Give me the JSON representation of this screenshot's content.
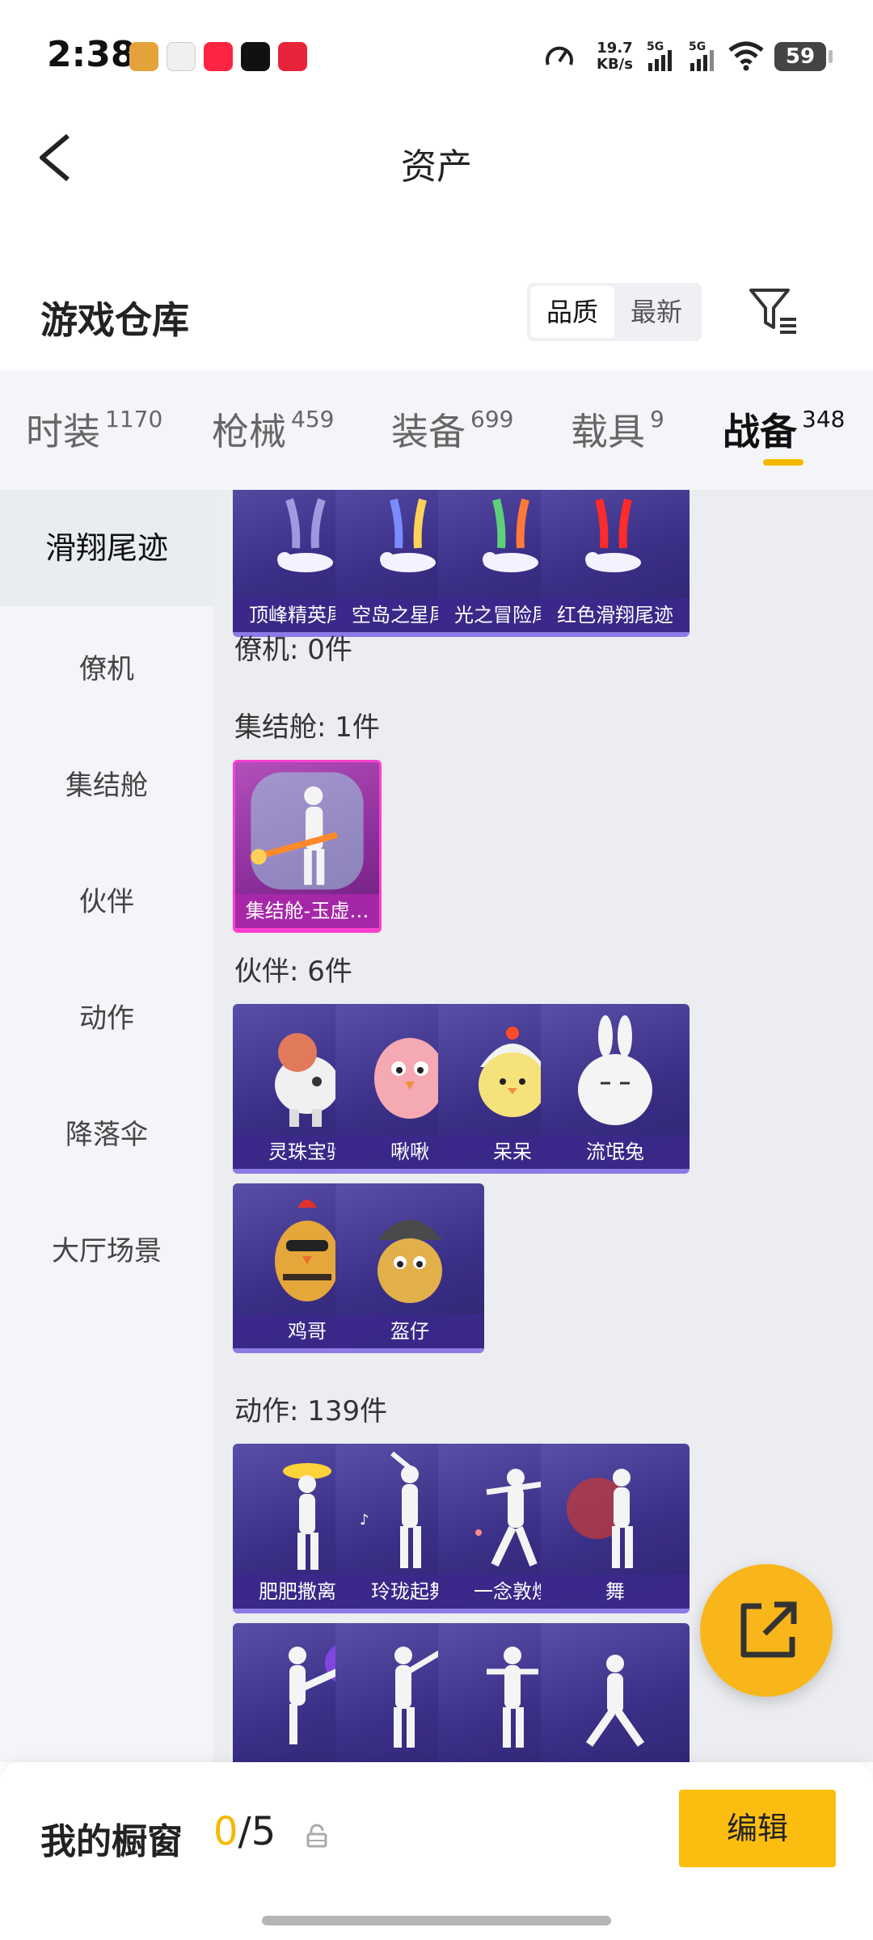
{
  "status_bar": {
    "time": "2:38",
    "net_speed_value": "19.7",
    "net_speed_unit": "KB/s",
    "signal1": "5G",
    "signal2": "5G",
    "battery": "59"
  },
  "header": {
    "title": "资产"
  },
  "warehouse": {
    "title": "游戏仓库",
    "sort_options": [
      "品质",
      "最新"
    ],
    "selected_sort": "品质"
  },
  "tabs": [
    {
      "label": "时装",
      "count": "1170"
    },
    {
      "label": "枪械",
      "count": "459"
    },
    {
      "label": "装备",
      "count": "699"
    },
    {
      "label": "载具",
      "count": "9"
    },
    {
      "label": "战备",
      "count": "348"
    }
  ],
  "active_tab": "战备",
  "sidebar": {
    "items": [
      "滑翔尾迹",
      "僚机",
      "集结舱",
      "伙伴",
      "动作",
      "降落伞",
      "大厅场景"
    ],
    "active": "滑翔尾迹"
  },
  "sections": {
    "trails": {
      "items": [
        "顶峰精英尾迹",
        "空岛之星尾迹",
        "光之冒险尾迹",
        "红色滑翔尾迹"
      ]
    },
    "wingman": {
      "title": "僚机: 0件"
    },
    "pod": {
      "title": "集结舱: 1件",
      "items": [
        "集结舱-玉虚…"
      ]
    },
    "partner": {
      "title": "伙伴: 6件",
      "items": [
        "灵珠宝驹",
        "啾啾",
        "呆呆",
        "流氓兔",
        "鸡哥",
        "盔仔"
      ]
    },
    "emote": {
      "title": "动作: 139件",
      "items": [
        "肥肥撒离舞",
        "玲珑起舞",
        "一念敦煌",
        "舞"
      ]
    }
  },
  "bottom_bar": {
    "showcase_label": "我的橱窗",
    "showcase_current": "0",
    "showcase_total": "/5",
    "edit_label": "编辑"
  },
  "colors": {
    "accent": "#f5b800",
    "card_purple": "#3a2f86",
    "card_pink": "#ff3fd0"
  }
}
